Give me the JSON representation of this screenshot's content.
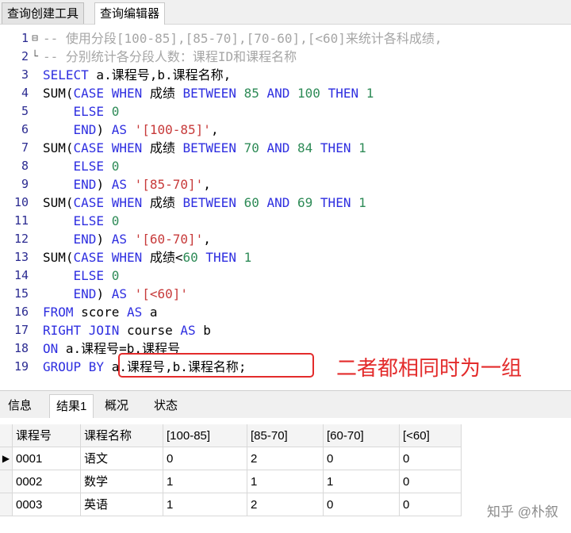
{
  "top_tabs": [
    "查询创建工具",
    "查询编辑器"
  ],
  "editor_lines": [
    [
      {
        "t": "-- 使用分段[100-85],[85-70],[70-60],[<60]来统计各科成绩,",
        "c": "cmt"
      }
    ],
    [
      {
        "t": "-- 分别统计各分段人数：课程ID和课程名称",
        "c": "cmt"
      }
    ],
    [
      {
        "t": "SELECT",
        "c": "kw"
      },
      {
        "t": " a.课程号,b.课程名称,",
        "c": "plain"
      }
    ],
    [
      {
        "t": "SUM(",
        "c": "plain"
      },
      {
        "t": "CASE WHEN",
        "c": "kw"
      },
      {
        "t": " 成绩 ",
        "c": "plain"
      },
      {
        "t": "BETWEEN",
        "c": "kw"
      },
      {
        "t": " 85 ",
        "c": "num"
      },
      {
        "t": "AND",
        "c": "kw"
      },
      {
        "t": " 100 ",
        "c": "num"
      },
      {
        "t": "THEN",
        "c": "kw"
      },
      {
        "t": " 1",
        "c": "num"
      }
    ],
    [
      {
        "t": "    ",
        "c": "plain"
      },
      {
        "t": "ELSE",
        "c": "kw"
      },
      {
        "t": " 0",
        "c": "num"
      }
    ],
    [
      {
        "t": "    ",
        "c": "plain"
      },
      {
        "t": "END",
        "c": "kw"
      },
      {
        "t": ") ",
        "c": "plain"
      },
      {
        "t": "AS",
        "c": "kw"
      },
      {
        "t": " '[100-85]'",
        "c": "str"
      },
      {
        "t": ",",
        "c": "plain"
      }
    ],
    [
      {
        "t": "SUM(",
        "c": "plain"
      },
      {
        "t": "CASE WHEN",
        "c": "kw"
      },
      {
        "t": " 成绩 ",
        "c": "plain"
      },
      {
        "t": "BETWEEN",
        "c": "kw"
      },
      {
        "t": " 70 ",
        "c": "num"
      },
      {
        "t": "AND",
        "c": "kw"
      },
      {
        "t": " 84 ",
        "c": "num"
      },
      {
        "t": "THEN",
        "c": "kw"
      },
      {
        "t": " 1",
        "c": "num"
      }
    ],
    [
      {
        "t": "    ",
        "c": "plain"
      },
      {
        "t": "ELSE",
        "c": "kw"
      },
      {
        "t": " 0",
        "c": "num"
      }
    ],
    [
      {
        "t": "    ",
        "c": "plain"
      },
      {
        "t": "END",
        "c": "kw"
      },
      {
        "t": ") ",
        "c": "plain"
      },
      {
        "t": "AS",
        "c": "kw"
      },
      {
        "t": " '[85-70]'",
        "c": "str"
      },
      {
        "t": ",",
        "c": "plain"
      }
    ],
    [
      {
        "t": "SUM(",
        "c": "plain"
      },
      {
        "t": "CASE WHEN",
        "c": "kw"
      },
      {
        "t": " 成绩 ",
        "c": "plain"
      },
      {
        "t": "BETWEEN",
        "c": "kw"
      },
      {
        "t": " 60 ",
        "c": "num"
      },
      {
        "t": "AND",
        "c": "kw"
      },
      {
        "t": " 69 ",
        "c": "num"
      },
      {
        "t": "THEN",
        "c": "kw"
      },
      {
        "t": " 1",
        "c": "num"
      }
    ],
    [
      {
        "t": "    ",
        "c": "plain"
      },
      {
        "t": "ELSE",
        "c": "kw"
      },
      {
        "t": " 0",
        "c": "num"
      }
    ],
    [
      {
        "t": "    ",
        "c": "plain"
      },
      {
        "t": "END",
        "c": "kw"
      },
      {
        "t": ") ",
        "c": "plain"
      },
      {
        "t": "AS",
        "c": "kw"
      },
      {
        "t": " '[60-70]'",
        "c": "str"
      },
      {
        "t": ",",
        "c": "plain"
      }
    ],
    [
      {
        "t": "SUM(",
        "c": "plain"
      },
      {
        "t": "CASE WHEN",
        "c": "kw"
      },
      {
        "t": " 成绩<",
        "c": "plain"
      },
      {
        "t": "60 ",
        "c": "num"
      },
      {
        "t": "THEN",
        "c": "kw"
      },
      {
        "t": " 1",
        "c": "num"
      }
    ],
    [
      {
        "t": "    ",
        "c": "plain"
      },
      {
        "t": "ELSE",
        "c": "kw"
      },
      {
        "t": " 0",
        "c": "num"
      }
    ],
    [
      {
        "t": "    ",
        "c": "plain"
      },
      {
        "t": "END",
        "c": "kw"
      },
      {
        "t": ") ",
        "c": "plain"
      },
      {
        "t": "AS",
        "c": "kw"
      },
      {
        "t": " '[<60]'",
        "c": "str"
      }
    ],
    [
      {
        "t": "FROM",
        "c": "kw"
      },
      {
        "t": " score ",
        "c": "plain"
      },
      {
        "t": "AS",
        "c": "kw"
      },
      {
        "t": " a",
        "c": "plain"
      }
    ],
    [
      {
        "t": "RIGHT JOIN",
        "c": "kw"
      },
      {
        "t": " course ",
        "c": "plain"
      },
      {
        "t": "AS",
        "c": "kw"
      },
      {
        "t": " b",
        "c": "plain"
      }
    ],
    [
      {
        "t": "ON",
        "c": "kw"
      },
      {
        "t": " a.课程号=b.课程号",
        "c": "plain"
      }
    ],
    [
      {
        "t": "GROUP BY",
        "c": "kw"
      },
      {
        "t": " a.课程号,b.课程名称;",
        "c": "plain"
      }
    ]
  ],
  "fold_markers": {
    "1": "⊟",
    "2": "└"
  },
  "annotation": "二者都相同时为一组",
  "colors": {
    "keyword": "#2e2ee0",
    "number": "#2e8b57",
    "string": "#c73a3a",
    "comment": "#a6a6a6",
    "annotation": "#e32b2b"
  },
  "bottom_tabs": [
    "信息",
    "结果1",
    "概况",
    "状态"
  ],
  "active_bottom_tab": "结果1",
  "results": {
    "columns": [
      "课程号",
      "课程名称",
      "[100-85]",
      "[85-70]",
      "[60-70]",
      "[<60]"
    ],
    "rows": [
      [
        "0001",
        "语文",
        "0",
        "2",
        "0",
        "0"
      ],
      [
        "0002",
        "数学",
        "1",
        "1",
        "1",
        "0"
      ],
      [
        "0003",
        "英语",
        "1",
        "2",
        "0",
        "0"
      ]
    ],
    "current_row_marker": "▶"
  },
  "watermark": "知乎 @朴叙"
}
